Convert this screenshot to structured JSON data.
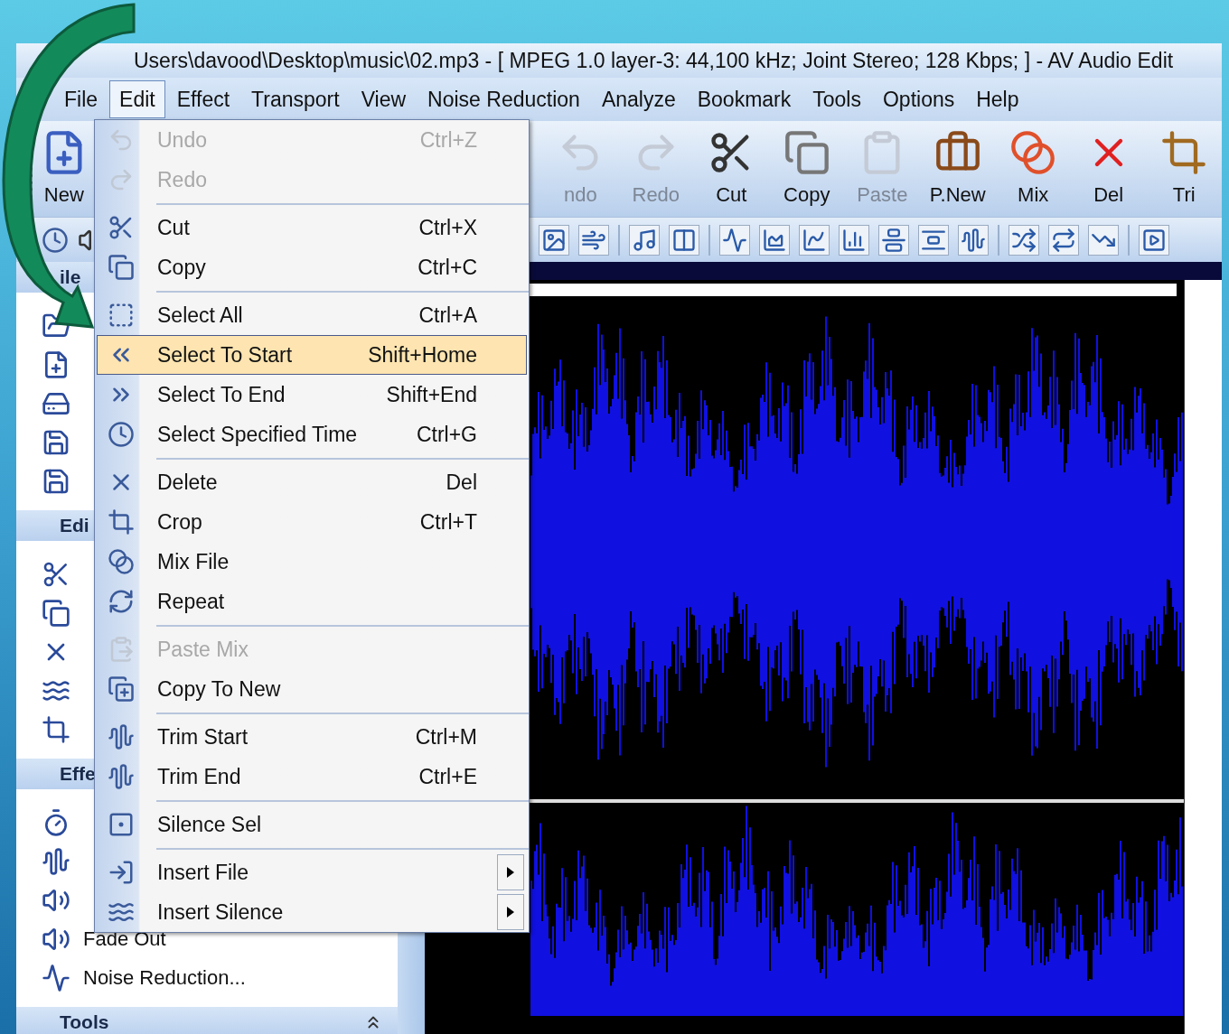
{
  "window": {
    "title": "Users\\davood\\Desktop\\music\\02.mp3 - [ MPEG 1.0 layer-3: 44,100 kHz; Joint Stereo; 128 Kbps;  ] - AV Audio Edit"
  },
  "menu_bar": [
    {
      "label": "File",
      "selected": false
    },
    {
      "label": "Edit",
      "selected": true
    },
    {
      "label": "Effect",
      "selected": false
    },
    {
      "label": "Transport",
      "selected": false
    },
    {
      "label": "View",
      "selected": false
    },
    {
      "label": "Noise Reduction",
      "selected": false
    },
    {
      "label": "Analyze",
      "selected": false
    },
    {
      "label": "Bookmark",
      "selected": false
    },
    {
      "label": "Tools",
      "selected": false
    },
    {
      "label": "Options",
      "selected": false
    },
    {
      "label": "Help",
      "selected": false
    }
  ],
  "toolbar": [
    {
      "label": "New",
      "disabled": false
    },
    {
      "label": "ndo",
      "disabled": true
    },
    {
      "label": "Redo",
      "disabled": true
    },
    {
      "label": "Cut",
      "disabled": false
    },
    {
      "label": "Copy",
      "disabled": false
    },
    {
      "label": "Paste",
      "disabled": true
    },
    {
      "label": "P.New",
      "disabled": false
    },
    {
      "label": "Mix",
      "disabled": false
    },
    {
      "label": "Del",
      "disabled": false
    },
    {
      "label": "Tri",
      "disabled": false
    }
  ],
  "sidebar": [
    {
      "heading": "ile"
    },
    {
      "heading": "Edi"
    },
    {
      "heading": "Effe",
      "items": [
        "Fade Out",
        "Noise Reduction..."
      ]
    },
    {
      "heading": "Tools"
    }
  ],
  "edit_menu": [
    {
      "kind": "item",
      "label": "Undo",
      "shortcut": "Ctrl+Z",
      "disabled": true,
      "selected": false,
      "submenu": false
    },
    {
      "kind": "item",
      "label": "Redo",
      "disabled": true,
      "selected": false,
      "submenu": false
    },
    {
      "kind": "separator"
    },
    {
      "kind": "item",
      "label": "Cut",
      "shortcut": "Ctrl+X",
      "disabled": false,
      "selected": false,
      "submenu": false
    },
    {
      "kind": "item",
      "label": "Copy",
      "shortcut": "Ctrl+C",
      "disabled": false,
      "selected": false,
      "submenu": false
    },
    {
      "kind": "separator"
    },
    {
      "kind": "item",
      "label": "Select All",
      "shortcut": "Ctrl+A",
      "disabled": false,
      "selected": false,
      "submenu": false
    },
    {
      "kind": "item",
      "label": "Select To Start",
      "shortcut": "Shift+Home",
      "disabled": false,
      "selected": true,
      "submenu": false
    },
    {
      "kind": "item",
      "label": "Select To End",
      "shortcut": "Shift+End",
      "disabled": false,
      "selected": false,
      "submenu": false
    },
    {
      "kind": "item",
      "label": "Select Specified Time",
      "shortcut": "Ctrl+G",
      "disabled": false,
      "selected": false,
      "submenu": false
    },
    {
      "kind": "separator"
    },
    {
      "kind": "item",
      "label": "Delete",
      "shortcut": "Del",
      "disabled": false,
      "selected": false,
      "submenu": false
    },
    {
      "kind": "item",
      "label": "Crop",
      "shortcut": "Ctrl+T",
      "disabled": false,
      "selected": false,
      "submenu": false
    },
    {
      "kind": "item",
      "label": "Mix File",
      "disabled": false,
      "selected": false,
      "submenu": false
    },
    {
      "kind": "item",
      "label": "Repeat",
      "disabled": false,
      "selected": false,
      "submenu": false
    },
    {
      "kind": "separator"
    },
    {
      "kind": "item",
      "label": "Paste Mix",
      "disabled": true,
      "selected": false,
      "submenu": false
    },
    {
      "kind": "item",
      "label": "Copy To New",
      "disabled": false,
      "selected": false,
      "submenu": false
    },
    {
      "kind": "separator"
    },
    {
      "kind": "item",
      "label": "Trim Start",
      "shortcut": "Ctrl+M",
      "disabled": false,
      "selected": false,
      "submenu": false
    },
    {
      "kind": "item",
      "label": "Trim End",
      "shortcut": "Ctrl+E",
      "disabled": false,
      "selected": false,
      "submenu": false
    },
    {
      "kind": "separator"
    },
    {
      "kind": "item",
      "label": "Silence Sel",
      "disabled": false,
      "selected": false,
      "submenu": false
    },
    {
      "kind": "separator"
    },
    {
      "kind": "item",
      "label": "Insert File",
      "disabled": false,
      "selected": false,
      "submenu": true
    },
    {
      "kind": "item",
      "label": "Insert Silence",
      "disabled": false,
      "selected": false,
      "submenu": true
    }
  ]
}
